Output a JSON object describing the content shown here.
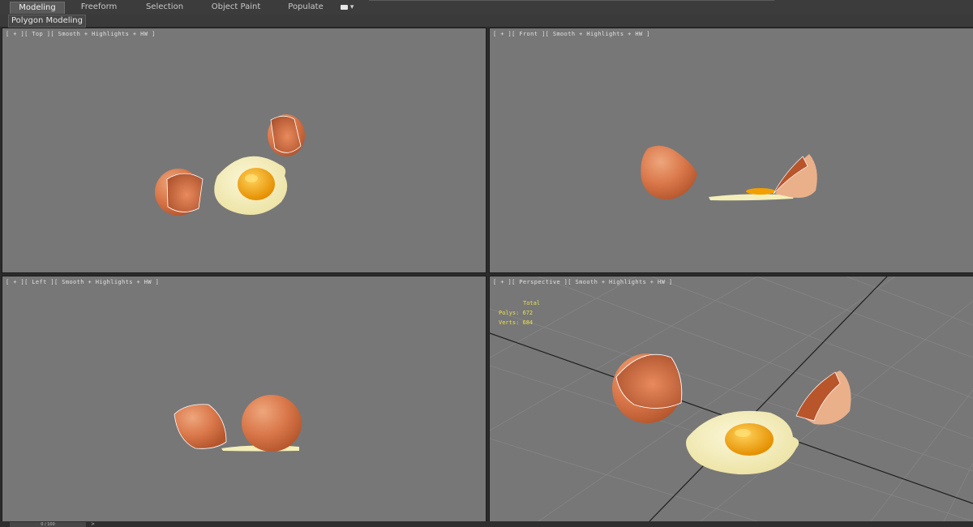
{
  "ribbon": {
    "tabs": [
      {
        "label": "Modeling",
        "active": true
      },
      {
        "label": "Freeform",
        "active": false
      },
      {
        "label": "Selection",
        "active": false
      },
      {
        "label": "Object Paint",
        "active": false
      },
      {
        "label": "Populate",
        "active": false
      }
    ],
    "extra_icon": "camera-icon",
    "subtab_label": "Polygon Modeling"
  },
  "viewports": {
    "top": {
      "label": "[ + ][ Top ][ Smooth + Highlights + HW ]"
    },
    "front": {
      "label": "[ + ][ Front ][ Smooth + Highlights + HW ]"
    },
    "left": {
      "label": "[ + ][ Left ][ Smooth + Highlights + HW ]"
    },
    "perspective": {
      "label": "[ + ][ Perspective ][ Smooth + Highlights + HW ]",
      "stats": {
        "header": "Total",
        "polys": "Polys: 672",
        "verts": "Verts: 684"
      }
    }
  },
  "timeline": {
    "position": "0 / 100"
  },
  "colors": {
    "viewport_bg": "#777777",
    "shell": "#d9774a",
    "egg_white": "#f4eeb8",
    "yolk": "#f2a000",
    "stats_text": "#e8e14a"
  }
}
